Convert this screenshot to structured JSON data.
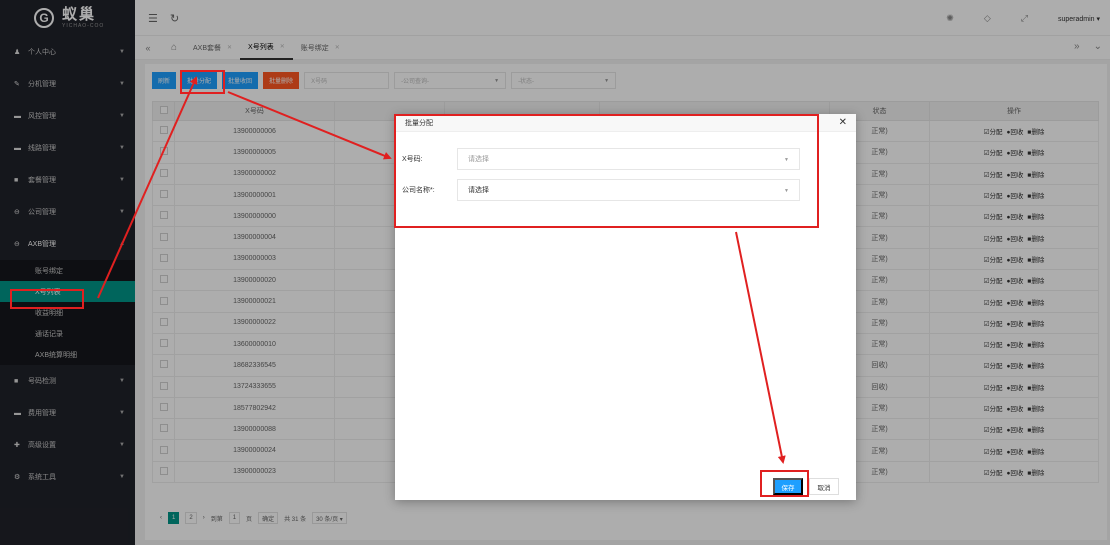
{
  "logo": {
    "cn": "蚁巢",
    "en": "YICHAO-COO"
  },
  "sidebar": {
    "items": [
      {
        "icon": "user-icon",
        "glyph": "♟",
        "label": "个人中心"
      },
      {
        "icon": "branch-icon",
        "glyph": "✎",
        "label": "分机管理"
      },
      {
        "icon": "shield-icon",
        "glyph": "▬",
        "label": "风控管理"
      },
      {
        "icon": "line-icon",
        "glyph": "▬",
        "label": "线路管理"
      },
      {
        "icon": "package-icon",
        "glyph": "■",
        "label": "套餐管理"
      },
      {
        "icon": "company-icon",
        "glyph": "⊖",
        "label": "公司管理"
      },
      {
        "icon": "axb-icon",
        "glyph": "⊖",
        "label": "AXB管理"
      }
    ],
    "sub": [
      {
        "label": "账号绑定"
      },
      {
        "label": "X号列表"
      },
      {
        "label": "收益明细"
      },
      {
        "label": "通话记录"
      },
      {
        "label": "AXB统算明细"
      }
    ],
    "items2": [
      {
        "icon": "number-detect-icon",
        "glyph": "■",
        "label": "号码检测"
      },
      {
        "icon": "fee-icon",
        "glyph": "▬",
        "label": "费用管理"
      },
      {
        "icon": "settings-icon",
        "glyph": "✚",
        "label": "高级设置"
      },
      {
        "icon": "tools-icon",
        "glyph": "⚙",
        "label": "系统工具"
      }
    ]
  },
  "topbar": {
    "user": "superadmin"
  },
  "tabs": [
    {
      "label": "AXB套餐"
    },
    {
      "label": "X号列表"
    },
    {
      "label": "账号绑定"
    }
  ],
  "toolbar": {
    "refresh": "刷新",
    "batch_assign": "批量分配",
    "batch_recycle": "批量收回",
    "batch_delete": "批量删除",
    "x_placeholder": "X号码",
    "company_placeholder": "-公司查询-",
    "status_placeholder": "-状态-"
  },
  "table": {
    "headers": [
      "",
      "X号码",
      "",
      "",
      "",
      "状态",
      "操作"
    ],
    "rows": [
      {
        "x": "13900000006",
        "status": "正常)"
      },
      {
        "x": "13900000005",
        "status": "正常)"
      },
      {
        "x": "13900000002",
        "status": "正常)"
      },
      {
        "x": "13900000001",
        "status": "正常)"
      },
      {
        "x": "13900000000",
        "status": "正常)"
      },
      {
        "x": "13900000004",
        "status": "正常)"
      },
      {
        "x": "13900000003",
        "status": "正常)"
      },
      {
        "x": "13900000020",
        "status": "正常)"
      },
      {
        "x": "13900000021",
        "status": "正常)"
      },
      {
        "x": "13900000022",
        "status": "正常)"
      },
      {
        "x": "13600000010",
        "status": "正常)"
      },
      {
        "x": "18682336545",
        "status": "回收)"
      },
      {
        "x": "13724333655",
        "status": "回收)"
      },
      {
        "x": "18577802942",
        "status": "正常)"
      },
      {
        "x": "13900000088",
        "status": "正常)"
      },
      {
        "x": "13900000024",
        "status": "正常)"
      },
      {
        "x": "13900000023",
        "status": "正常)"
      }
    ],
    "ops": {
      "assign": "☑分配",
      "recycle": "●回收",
      "delete": "■删除"
    }
  },
  "pager": {
    "page1": "1",
    "page2": "2",
    "goto_label": "到第",
    "goto_value": "1",
    "page_suffix": "页",
    "confirm": "确定",
    "total": "共 31 条",
    "per_page": "30 条/页 ▾"
  },
  "dialog": {
    "title": "批量分配",
    "x_label": "X号码:",
    "x_placeholder": "请选择",
    "company_label": "公司名称*:",
    "company_placeholder": "请选择",
    "save": "保存",
    "cancel": "取消"
  },
  "colors": {
    "accent": "#009688",
    "primary": "#1e9fff",
    "danger": "#ff5722",
    "annotation": "#e02020"
  }
}
